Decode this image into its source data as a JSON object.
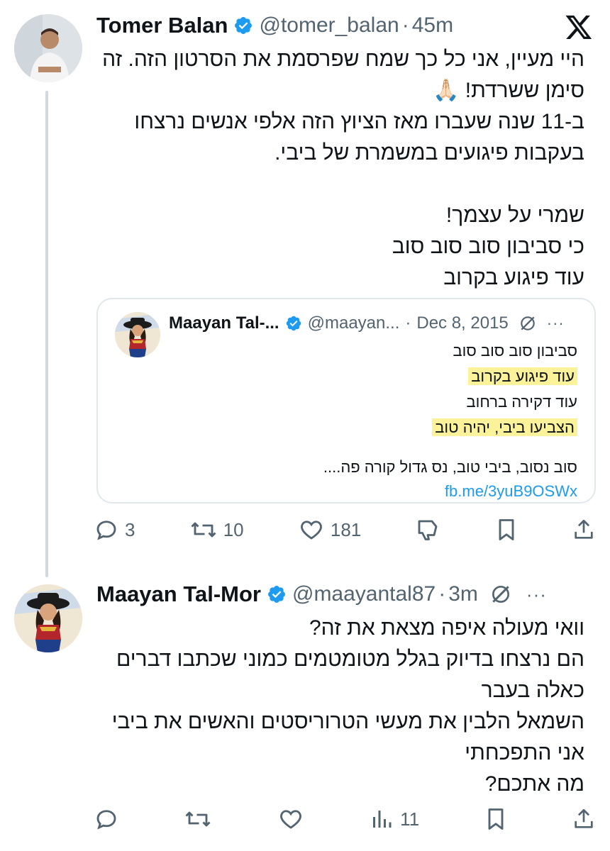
{
  "tweet1": {
    "author_name": "Tomer Balan",
    "handle": "@tomer_balan",
    "separator": "·",
    "time": "45m",
    "text_lines": [
      "היי מעיין, אני כל כך שמח שפרסמת את הסרטון הזה. זה",
      "סימן ששרדת! 🙏🏻",
      "ב-11 שנה שעברו מאז הציוץ הזה אלפי אנשים נרצחו",
      "בעקבות פיגועים במשמרת של ביבי.",
      "",
      "שמרי על עצמך!",
      "כי סביבון סוב סוב סוב",
      "עוד פיגוע בקרוב"
    ],
    "quote": {
      "author_name": "Maayan Tal-...",
      "handle": "@maayan...",
      "separator": "·",
      "date": "Dec 8, 2015",
      "more": "···",
      "lines": [
        "סביבון סוב סוב סוב",
        "עוד פיגוע בקרוב",
        "עוד דקירה ברחוב",
        "הצביעו ביבי, יהיה טוב",
        "סוב נסוב, ביבי טוב, נס גדול קורה פה....",
        "fb.me/3yuB9OSWx"
      ]
    },
    "actions": {
      "replies": "3",
      "retweets": "10",
      "likes": "181"
    }
  },
  "tweet2": {
    "author_name": "Maayan Tal-Mor",
    "handle": "@maayantal87",
    "separator": "·",
    "time": "3m",
    "more": "···",
    "text_lines": [
      "וואי מעולה איפה מצאת את זה?",
      "הם נרצחו בדיוק בגלל מטומטמים כמוני שכתבו דברים",
      "כאלה בעבר",
      "השמאל הלבין את מעשי הטרוריסטים והאשים את ביבי",
      "אני התפכחתי",
      "מה אתכם?"
    ],
    "actions": {
      "views": "11"
    }
  },
  "colors": {
    "verified": "#1d9bf0",
    "secondary_text": "#536471",
    "link": "#1d9bf0",
    "highlight": "#fbf29a",
    "border": "#e1e8ed"
  }
}
